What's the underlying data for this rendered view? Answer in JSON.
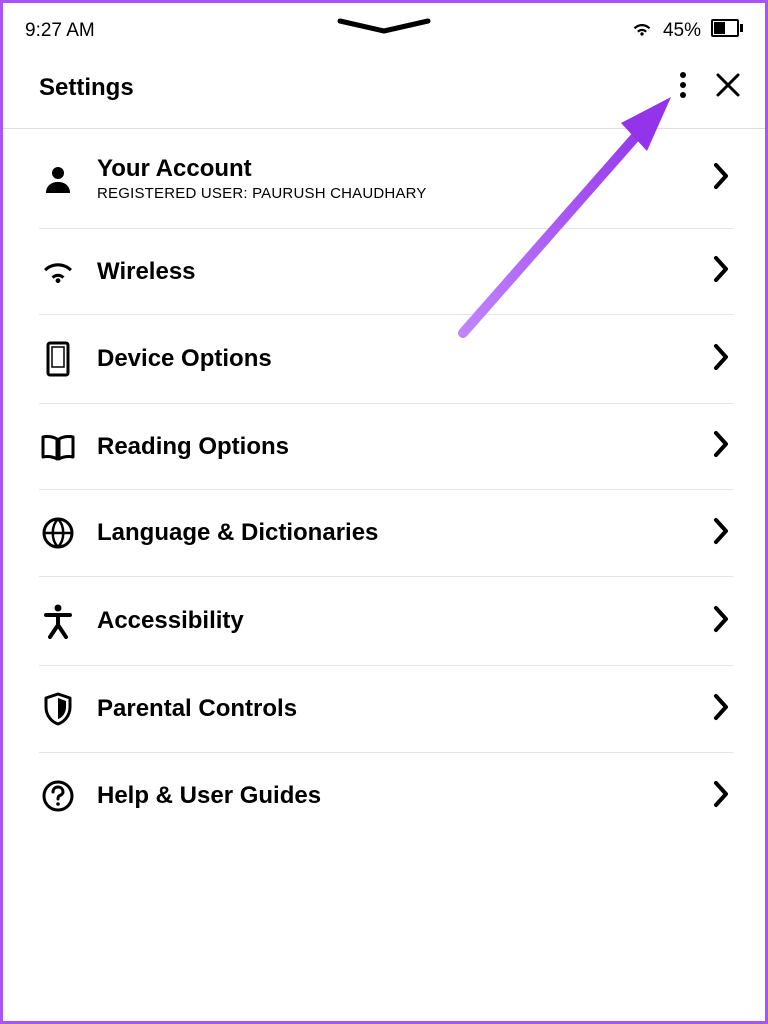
{
  "status": {
    "time": "9:27 AM",
    "battery_pct": "45%"
  },
  "header": {
    "title": "Settings"
  },
  "items": [
    {
      "title": "Your Account",
      "sub": "REGISTERED USER: PAURUSH CHAUDHARY"
    },
    {
      "title": "Wireless",
      "sub": ""
    },
    {
      "title": "Device Options",
      "sub": ""
    },
    {
      "title": "Reading Options",
      "sub": ""
    },
    {
      "title": "Language & Dictionaries",
      "sub": ""
    },
    {
      "title": "Accessibility",
      "sub": ""
    },
    {
      "title": "Parental Controls",
      "sub": ""
    },
    {
      "title": "Help & User Guides",
      "sub": ""
    }
  ],
  "annotation": {
    "arrow_color": "#a855f7"
  }
}
